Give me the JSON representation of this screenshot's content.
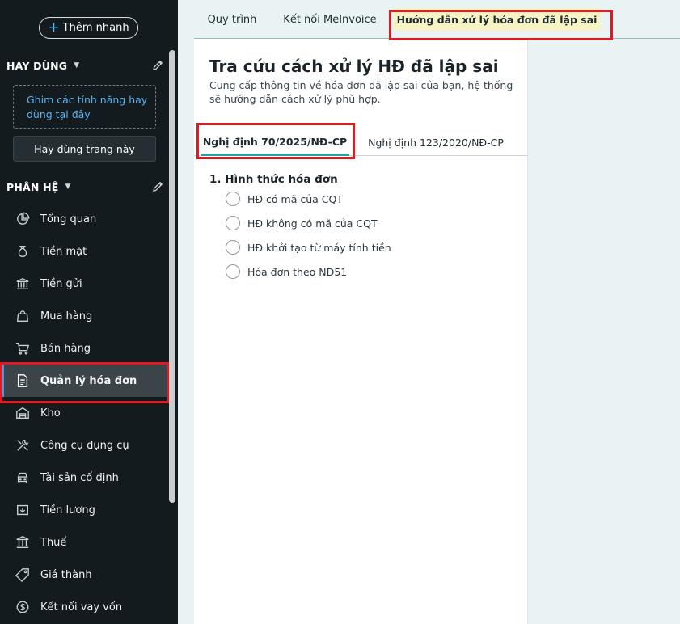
{
  "sidebar": {
    "quick_add_label": "Thêm nhanh",
    "favorites": {
      "heading": "HAY DÙNG",
      "pin_hint": "Ghim các tính năng hay dùng tại đây",
      "pin_page_button": "Hay dùng trang này"
    },
    "modules": {
      "heading": "PHÂN HỆ",
      "items": [
        {
          "label": "Tổng quan",
          "icon": "pie-chart-icon"
        },
        {
          "label": "Tiền mặt",
          "icon": "money-bag-icon"
        },
        {
          "label": "Tiền gửi",
          "icon": "bank-icon"
        },
        {
          "label": "Mua hàng",
          "icon": "shopping-bag-icon"
        },
        {
          "label": "Bán hàng",
          "icon": "cart-icon"
        },
        {
          "label": "Quản lý hóa đơn",
          "icon": "invoice-icon",
          "active": true
        },
        {
          "label": "Kho",
          "icon": "warehouse-icon"
        },
        {
          "label": "Công cụ dụng cụ",
          "icon": "tools-icon"
        },
        {
          "label": "Tài sản cố định",
          "icon": "car-icon"
        },
        {
          "label": "Tiền lương",
          "icon": "salary-icon"
        },
        {
          "label": "Thuế",
          "icon": "tax-building-icon"
        },
        {
          "label": "Giá thành",
          "icon": "price-tag-icon"
        },
        {
          "label": "Kết nối vay vốn",
          "icon": "loan-icon"
        }
      ]
    }
  },
  "tabs": [
    {
      "label": "Quy trình"
    },
    {
      "label": "Kết nối MeInvoice"
    },
    {
      "label": "Hướng dẫn xử lý hóa đơn đã lập sai",
      "active": true
    }
  ],
  "content": {
    "title": "Tra cứu cách xử lý HĐ đã lập sai",
    "description": "Cung cấp thông tin về hóa đơn đã lập sai của bạn, hệ thống sẽ hướng dẫn cách xử lý phù hợp.",
    "subtabs": [
      {
        "label": "Nghị định 70/2025/NĐ-CP",
        "active": true
      },
      {
        "label": "Nghị định 123/2020/NĐ-CP"
      }
    ],
    "question_label": "1. Hình thức hóa đơn",
    "options": [
      "HĐ có mã của CQT",
      "HĐ không có mã của CQT",
      "HĐ khởi tạo từ máy tính tiền",
      "Hóa đơn theo NĐ51"
    ]
  },
  "colors": {
    "sidebar_bg": "#131b1f",
    "active_tab_bg": "#f6f3c5",
    "accent_teal": "#26a0a0",
    "highlight_red": "#e01a22"
  }
}
